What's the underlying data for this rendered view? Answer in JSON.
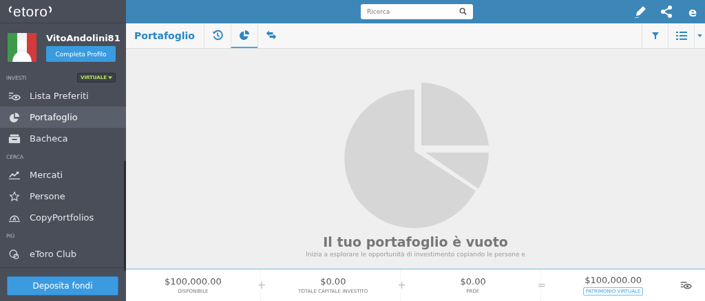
{
  "sidebar": {
    "logo": "etoro",
    "profile": {
      "username": "VitoAndolini81",
      "button": "Completa Profilo"
    },
    "sections": [
      {
        "label": "INVESTI",
        "badge": "VIRTUALE",
        "items": [
          {
            "label": "Lista Preferiti",
            "selected": false
          },
          {
            "label": "Portafoglio",
            "selected": true
          },
          {
            "label": "Bacheca",
            "selected": false
          }
        ]
      },
      {
        "label": "CERCA",
        "items": [
          {
            "label": "Mercati",
            "selected": false
          },
          {
            "label": "Persone",
            "selected": false
          },
          {
            "label": "CopyPortfolios",
            "selected": false
          }
        ]
      },
      {
        "label": "PIÙ",
        "items": [
          {
            "label": "eToro Club",
            "selected": false
          }
        ]
      }
    ],
    "deposit_button": "Deposita fondi"
  },
  "topbar": {
    "search": {
      "placeholder": "Ricerca"
    },
    "logo_letter": "e"
  },
  "toolbar": {
    "title": "Portafoglio",
    "tabs": [
      {
        "selected": false
      },
      {
        "selected": true
      },
      {
        "selected": false
      }
    ]
  },
  "empty_state": {
    "title": "Il tuo portafoglio è vuoto",
    "subtitle": "Inizia a esplorare le opportunità di investimento copiando le persone e"
  },
  "footer": {
    "stats": [
      {
        "value": "$100,000.00",
        "label": "DISPONIBILE",
        "operator": "+"
      },
      {
        "value": "$0.00",
        "label": "TOTALE CAPITALE INVESTITO",
        "operator": "+"
      },
      {
        "value": "$0.00",
        "label": "PROF.",
        "operator": "="
      },
      {
        "value": "$100,000.00",
        "label": "PATRIMONIO VIRTUALE"
      }
    ]
  }
}
